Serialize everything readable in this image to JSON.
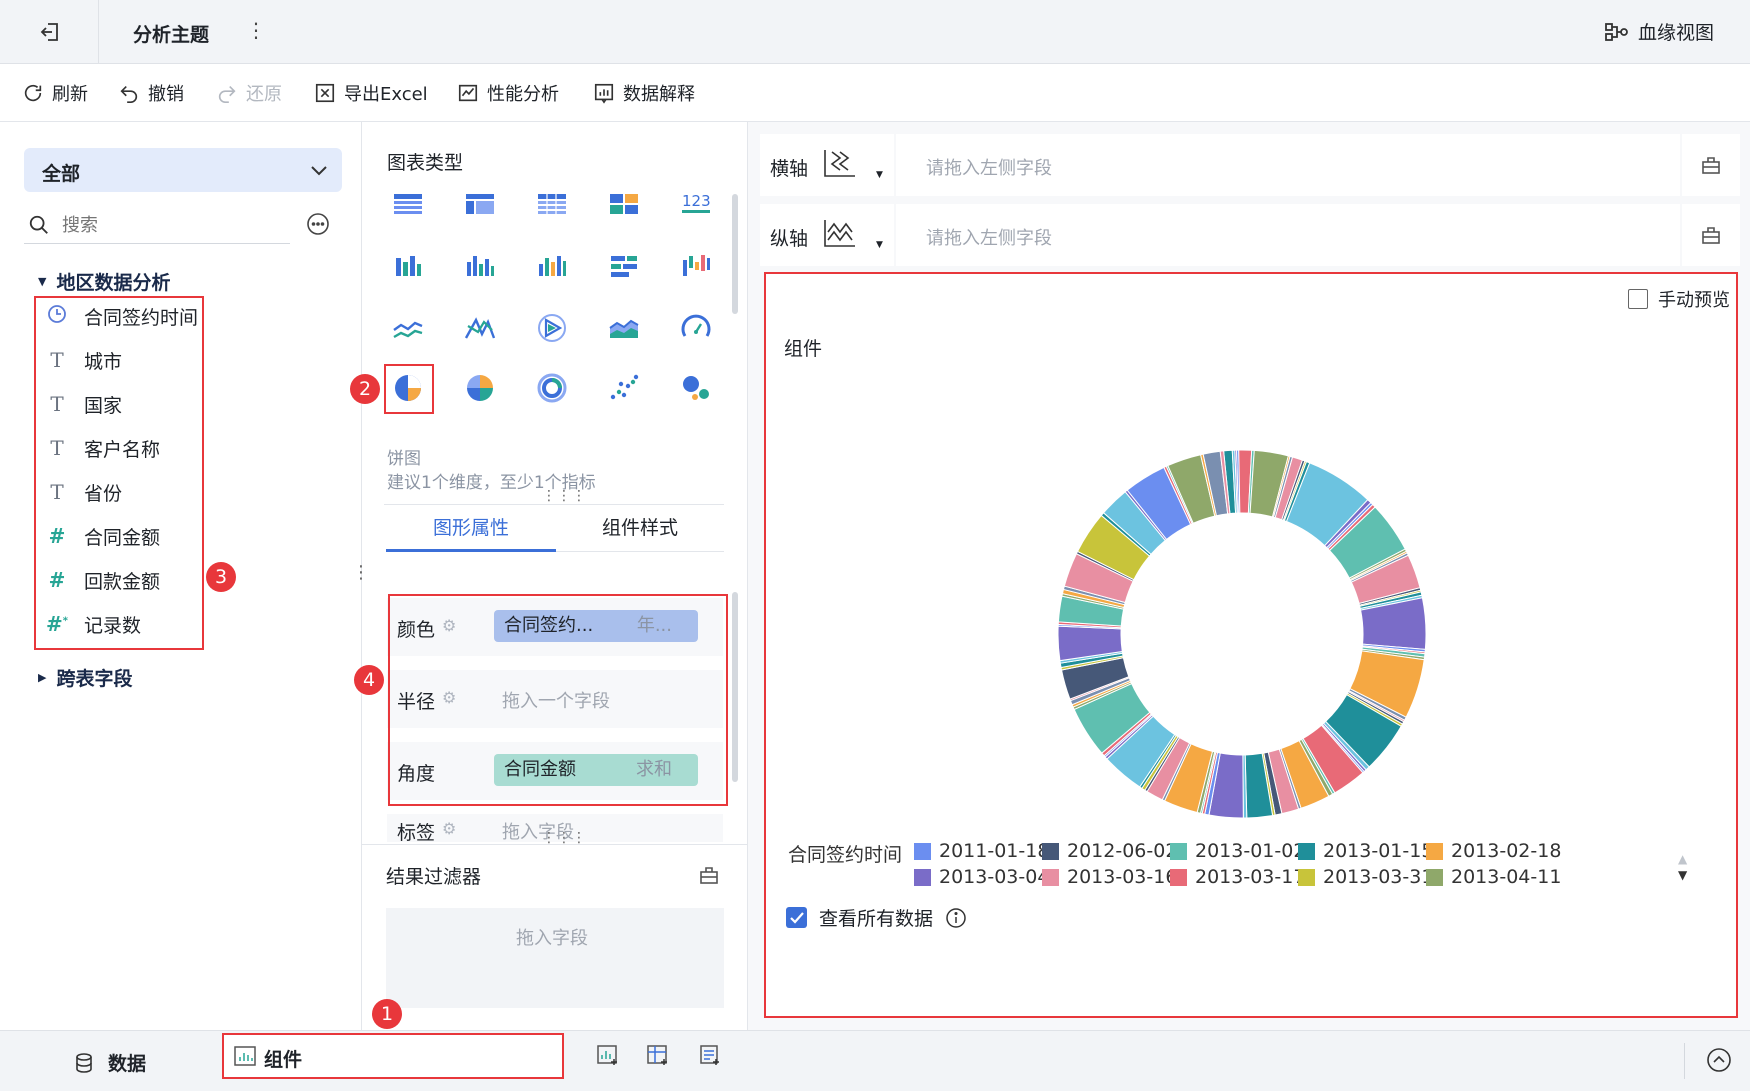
{
  "header": {
    "title": "分析主题",
    "lineage_label": "血缘视图"
  },
  "toolbar": {
    "refresh": "刷新",
    "undo": "撤销",
    "redo": "还原",
    "export": "导出Excel",
    "perf": "性能分析",
    "explain": "数据解释"
  },
  "left": {
    "scope_select": "全部",
    "search_placeholder": "搜索",
    "group_title": "地区数据分析",
    "fields": [
      {
        "name": "合同签约时间",
        "icon": "clock-icon"
      },
      {
        "name": "城市",
        "icon": "text-icon"
      },
      {
        "name": "国家",
        "icon": "text-icon"
      },
      {
        "name": "客户名称",
        "icon": "text-icon"
      },
      {
        "name": "省份",
        "icon": "text-icon"
      },
      {
        "name": "合同金额",
        "icon": "number-icon"
      },
      {
        "name": "回款金额",
        "icon": "number-icon"
      },
      {
        "name": "记录数",
        "icon": "count-icon"
      }
    ],
    "cross_table": "跨表字段"
  },
  "middle": {
    "chart_type_title": "图表类型",
    "selected_chart_name": "饼图",
    "selected_chart_hint": "建议1个维度，至少1个指标",
    "tabs": [
      "图形属性",
      "组件样式"
    ],
    "props": {
      "color_label": "颜色",
      "color_field": "合同签约...",
      "color_agg": "年...",
      "radius_label": "半径",
      "radius_placeholder": "拖入一个字段",
      "angle_label": "角度",
      "angle_field": "合同金额",
      "angle_agg": "求和",
      "tag_label": "标签",
      "tag_placeholder": "拖入字段"
    },
    "filter_title": "结果过滤器",
    "filter_placeholder": "拖入字段"
  },
  "right": {
    "x_axis_label": "横轴",
    "y_axis_label": "纵轴",
    "axis_placeholder": "请拖入左侧字段",
    "manual_preview": "手动预览",
    "chart_title": "组件",
    "legend_title": "合同签约时间",
    "view_all": "查看所有数据"
  },
  "badges": [
    "1",
    "2",
    "3",
    "4"
  ],
  "bottom": {
    "data_tab": "数据",
    "component_tab": "组件"
  },
  "colors": {
    "accent": "#3b6fd8",
    "red": "#e8373b",
    "pill_blue": "#a9bfec",
    "pill_green": "#a8dcd2"
  },
  "chart_data": {
    "type": "pie",
    "donut": true,
    "legend_series": [
      {
        "label": "2011-01-18",
        "color": "#6b8ef0"
      },
      {
        "label": "2012-06-02",
        "color": "#465878"
      },
      {
        "label": "2013-01-02",
        "color": "#5fbfb0"
      },
      {
        "label": "2013-01-15",
        "color": "#1f8f9a"
      },
      {
        "label": "2013-02-18",
        "color": "#f5a843"
      },
      {
        "label": "2013-03-04",
        "color": "#7a6cc8"
      },
      {
        "label": "2013-03-16",
        "color": "#e88fa2"
      },
      {
        "label": "2013-03-17",
        "color": "#e86a77"
      },
      {
        "label": "2013-03-31",
        "color": "#c8c43a"
      },
      {
        "label": "2013-04-11",
        "color": "#8fa86a"
      }
    ]
  }
}
